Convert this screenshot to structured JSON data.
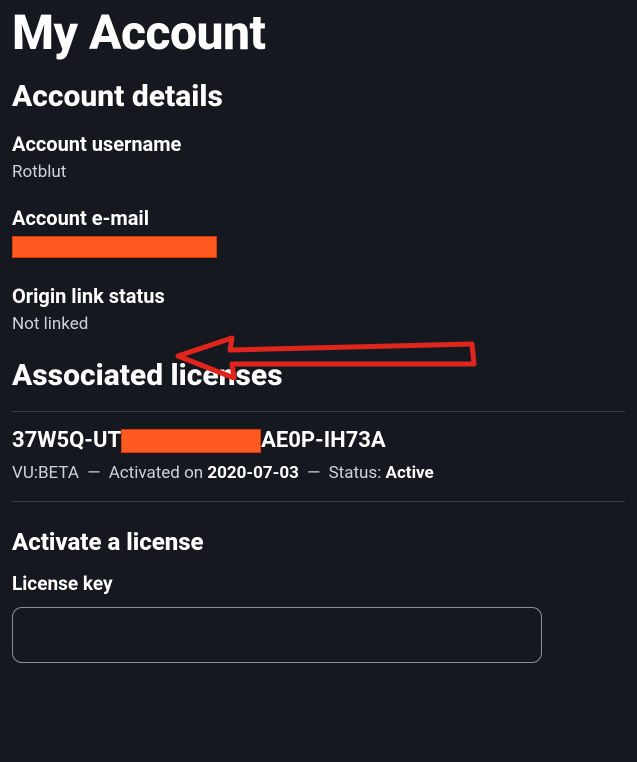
{
  "page_title": "My Account",
  "sections": {
    "account_details": {
      "title": "Account details",
      "username_label": "Account username",
      "username_value": "Rotblut",
      "email_label": "Account e-mail",
      "email_value_redacted": true,
      "origin_link_label": "Origin link status",
      "origin_link_value": "Not linked"
    },
    "associated_licenses": {
      "title": "Associated licenses",
      "licenses": [
        {
          "key_prefix": "37W5Q-UT",
          "key_redacted": true,
          "key_suffix": "AE0P-IH73A",
          "product": "VU:BETA",
          "activated_label": "Activated on",
          "activated_date": "2020-07-03",
          "status_label": "Status:",
          "status_value": "Active"
        }
      ]
    },
    "activate": {
      "title": "Activate a license",
      "input_label": "License key",
      "input_value": ""
    }
  },
  "annotation": {
    "arrow_color": "#e0261c",
    "points_to": "origin_link_value"
  }
}
